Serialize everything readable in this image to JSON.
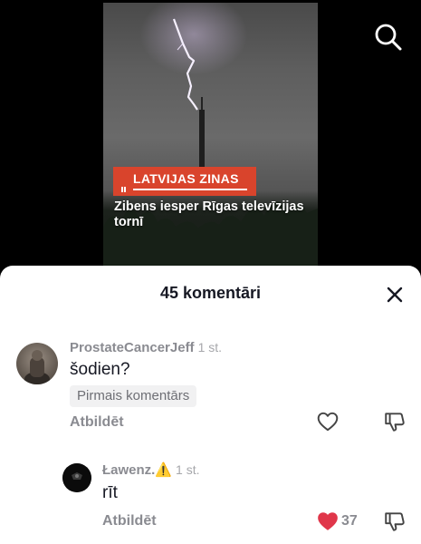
{
  "video": {
    "news_tag": "LATVIJAS ZINAS",
    "headline": "Zibens iesper Rīgas televīzijas tornī"
  },
  "icons": {
    "search": "search-icon",
    "close": "close-icon",
    "like": "heart-icon",
    "dislike": "thumbs-down-icon"
  },
  "comments_panel": {
    "title": "45 komentāri",
    "comments": [
      {
        "username": "ProstateCancerJeff",
        "time": "1 st.",
        "text": "šodien?",
        "badge": "Pirmais komentārs",
        "reply_label": "Atbildēt",
        "liked": false
      },
      {
        "username": "Ławenz.⚠️",
        "time": "1 st.",
        "text": "rīt",
        "reply_label": "Atbildēt",
        "liked": true,
        "like_count": "37"
      }
    ]
  },
  "colors": {
    "accent_like": "#e0364a",
    "news_tag_bg": "#d9442c",
    "text_primary": "#161823",
    "text_secondary": "#8a8b91"
  }
}
